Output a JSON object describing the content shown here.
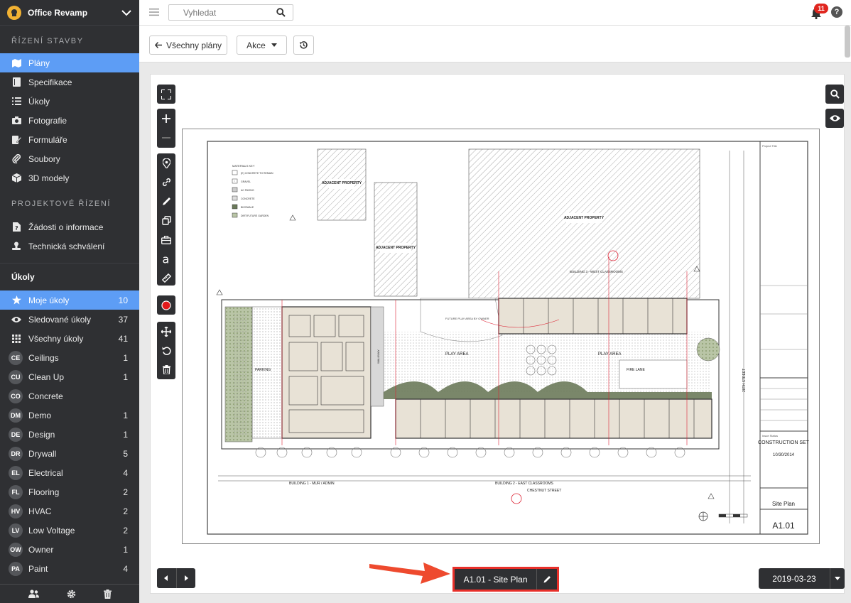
{
  "app": {
    "name": "Office Revamp"
  },
  "sidebar": {
    "section_construction": "ŘÍZENÍ STAVBY",
    "construction_items": [
      {
        "label": "Plány",
        "icon": "map-icon",
        "active": true
      },
      {
        "label": "Specifikace",
        "icon": "book-icon"
      },
      {
        "label": "Úkoly",
        "icon": "list-icon"
      },
      {
        "label": "Fotografie",
        "icon": "camera-icon"
      },
      {
        "label": "Formuláře",
        "icon": "form-icon"
      },
      {
        "label": "Soubory",
        "icon": "paperclip-icon"
      },
      {
        "label": "3D modely",
        "icon": "cube-icon"
      }
    ],
    "section_project": "PROJEKTOVÉ ŘÍZENÍ",
    "project_items": [
      {
        "label": "Žádosti o informace",
        "icon": "file-question-icon"
      },
      {
        "label": "Technická schválení",
        "icon": "stamp-icon"
      }
    ],
    "tasks_heading": "Úkoly",
    "task_filters": [
      {
        "label": "Moje úkoly",
        "count": "10",
        "icon": "star-icon",
        "active": true
      },
      {
        "label": "Sledované úkoly",
        "count": "37",
        "icon": "eye-icon"
      },
      {
        "label": "Všechny úkoly",
        "count": "41",
        "icon": "grid-icon"
      }
    ],
    "tags": [
      {
        "abbr": "CE",
        "label": "Ceilings",
        "count": "1"
      },
      {
        "abbr": "CU",
        "label": "Clean Up",
        "count": "1"
      },
      {
        "abbr": "CO",
        "label": "Concrete",
        "count": ""
      },
      {
        "abbr": "DM",
        "label": "Demo",
        "count": "1"
      },
      {
        "abbr": "DE",
        "label": "Design",
        "count": "1"
      },
      {
        "abbr": "DR",
        "label": "Drywall",
        "count": "5"
      },
      {
        "abbr": "EL",
        "label": "Electrical",
        "count": "4"
      },
      {
        "abbr": "FL",
        "label": "Flooring",
        "count": "2"
      },
      {
        "abbr": "HV",
        "label": "HVAC",
        "count": "2"
      },
      {
        "abbr": "LV",
        "label": "Low Voltage",
        "count": "2"
      },
      {
        "abbr": "OW",
        "label": "Owner",
        "count": "1"
      },
      {
        "abbr": "PA",
        "label": "Paint",
        "count": "4"
      }
    ]
  },
  "topbar": {
    "search_placeholder": "Vyhledat",
    "notifications_count": "11",
    "help_label": "?"
  },
  "toolbar": {
    "back_label": "Všechny plány",
    "actions_label": "Akce"
  },
  "viewer": {
    "sheet_label": "A1.01 - Site Plan",
    "date_label": "2019-03-23"
  },
  "drawing": {
    "materials_key_title": "MATERIALS KEY",
    "materials": [
      "(E) CONCRETE TO REMAIN",
      "GRAVEL",
      "AC PAVING",
      "CONCRETE",
      "BIOSWALE",
      "DIRT/FUTURE GARDEN"
    ],
    "adjacent_property": "ADJACENT PROPERTY",
    "building_1": "BUILDING 1 - MUR / ADMIN",
    "building_2": "BUILDING 2 - EAST CLASSROOMS",
    "building_3": "BUILDING 3 - WEST CLASSROOMS",
    "street_chestnut": "CHESTNUT STREET",
    "street_28th": "28TH STREET",
    "parking": "PARKING",
    "play_area": "PLAY AREA",
    "fire_lane": "FIRE LANE",
    "walkway": "WALKWAY",
    "future_play_area": "FUTURE PLAY AREA BY OWNER",
    "title_block": {
      "project_title": "Project Title",
      "issue_status": "Issue Status",
      "construction_set": "CONSTRUCTION SET",
      "date": "10/30/2014",
      "sheet_title": "Site Plan",
      "sheet_no": "A1.01"
    }
  },
  "colors": {
    "sidebar_bg": "#2f3033",
    "active_blue": "#5d9df5",
    "badge_red": "#e0261f",
    "highlight_red": "#e8302a"
  }
}
